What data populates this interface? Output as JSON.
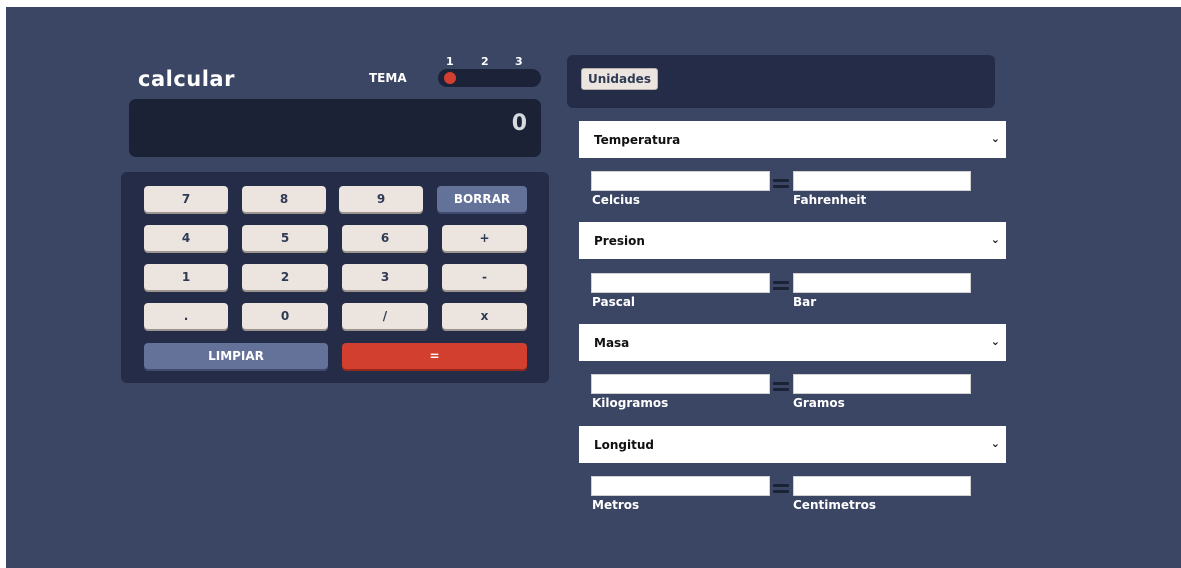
{
  "calculator": {
    "title": "calcular",
    "theme": {
      "label": "TEMA",
      "options": [
        "1",
        "2",
        "3"
      ],
      "selected": "1"
    },
    "display_value": "0",
    "keys": {
      "k7": "7",
      "k8": "8",
      "k9": "9",
      "del": "BORRAR",
      "k4": "4",
      "k5": "5",
      "k6": "6",
      "plus": "+",
      "k1": "1",
      "k2": "2",
      "k3": "3",
      "minus": "-",
      "dot": ".",
      "k0": "0",
      "divide": "/",
      "multiply": "x",
      "reset": "LIMPIAR",
      "equals": "="
    }
  },
  "converter": {
    "units_button": "Unidades",
    "groups": [
      {
        "select": "Temperatura",
        "from_label": "Celcius",
        "to_label": "Fahrenheit",
        "from_value": "",
        "to_value": ""
      },
      {
        "select": "Presion",
        "from_label": "Pascal",
        "to_label": "Bar",
        "from_value": "",
        "to_value": ""
      },
      {
        "select": "Masa",
        "from_label": "Kilogramos",
        "to_label": "Gramos",
        "from_value": "",
        "to_value": ""
      },
      {
        "select": "Longitud",
        "from_label": "Metros",
        "to_label": "Centimetros",
        "from_value": "",
        "to_value": ""
      }
    ]
  },
  "colors": {
    "background": "#3b4664",
    "panel": "#242c47",
    "display": "#1b2236",
    "key": "#ece5df",
    "key_accent": "#647198",
    "key_equals": "#d33f2e"
  }
}
